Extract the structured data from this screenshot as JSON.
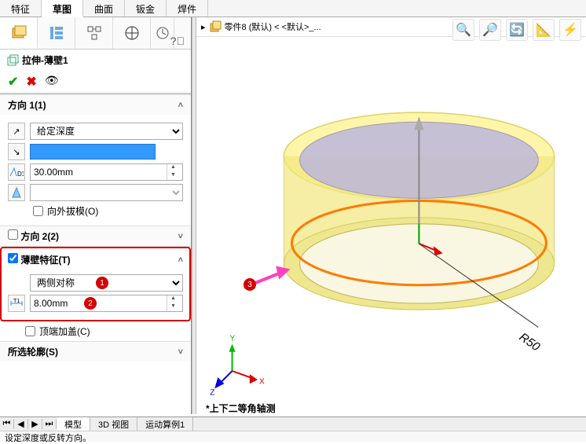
{
  "top_tabs": [
    "特征",
    "草图",
    "曲面",
    "钣金",
    "焊件"
  ],
  "active_top_tab": 1,
  "breadcrumb": {
    "part_icon": "part",
    "text": "零件8 (默认) < <默认>_..."
  },
  "feature_name": "拉伸-薄壁1",
  "direction1": {
    "title": "方向 1(1)",
    "end_condition": "给定深度",
    "depth": "30.00mm",
    "draft_label": "向外拔模(O)"
  },
  "direction2": {
    "title": "方向 2(2)",
    "enabled": false
  },
  "thin": {
    "title": "薄壁特征(T)",
    "type": "两侧对称",
    "thickness": "8.00mm",
    "cap_label": "顶端加盖(C)",
    "badge1": "1",
    "badge2": "2"
  },
  "contours": {
    "title": "所选轮廓(S)"
  },
  "viewport": {
    "badge3": "3",
    "dim_label": "R50",
    "view_label": "*上下二等角轴测",
    "axes": {
      "y": "Y",
      "x": "X",
      "z": "Z"
    }
  },
  "bottom_tabs": [
    "模型",
    "3D 视图",
    "运动算例1"
  ],
  "status_text": "设定深度或反转方向。"
}
